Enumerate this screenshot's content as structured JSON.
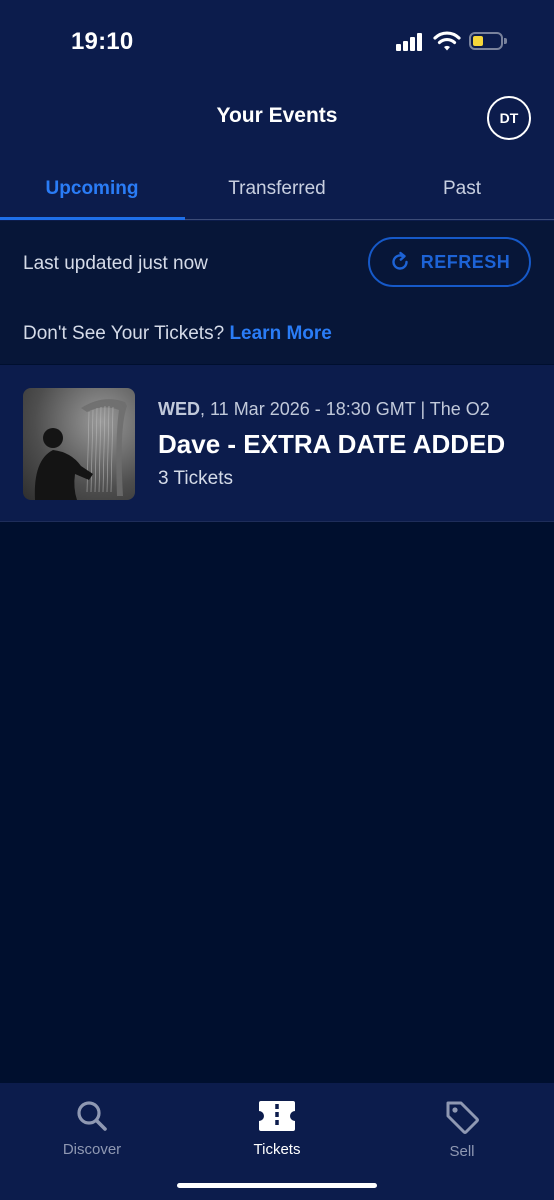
{
  "status_bar": {
    "time": "19:10"
  },
  "header": {
    "title": "Your Events",
    "avatar_initials": "DT"
  },
  "tabs": [
    {
      "label": "Upcoming",
      "active": true
    },
    {
      "label": "Transferred",
      "active": false
    },
    {
      "label": "Past",
      "active": false
    }
  ],
  "info": {
    "last_updated": "Last updated just now",
    "refresh_label": "REFRESH",
    "help_text": "Don't See Your Tickets?",
    "help_link": "Learn More"
  },
  "events": [
    {
      "day": "WED",
      "details": ", 11 Mar 2026 - 18:30 GMT | The O2",
      "title": "Dave - EXTRA DATE ADDED",
      "ticket_count": "3 Tickets"
    }
  ],
  "bottom_nav": [
    {
      "label": "Discover",
      "icon": "search-icon",
      "active": false
    },
    {
      "label": "Tickets",
      "icon": "ticket-icon",
      "active": true
    },
    {
      "label": "Sell",
      "icon": "tag-icon",
      "active": false
    }
  ],
  "colors": {
    "background": "#000f2e",
    "surface": "#0c1c4c",
    "accent": "#2a7cf6",
    "battery": "#f5d63a"
  }
}
